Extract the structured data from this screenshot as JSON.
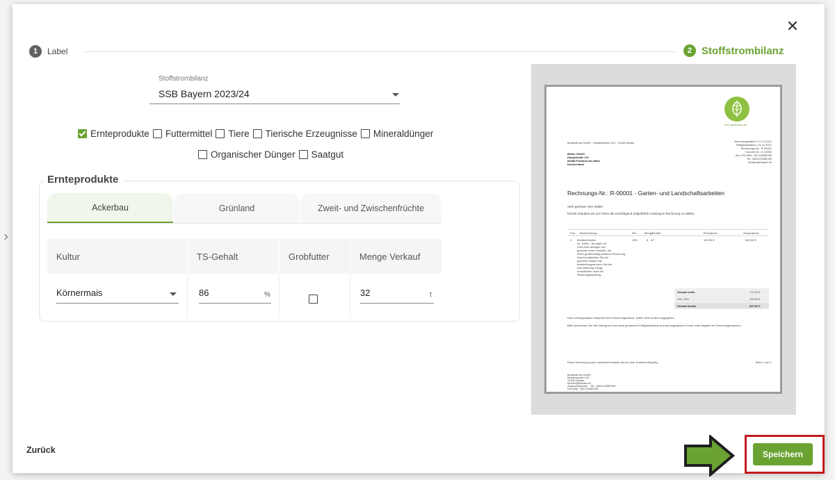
{
  "stepper": {
    "step1": {
      "number": "1",
      "label": "Label"
    },
    "step2": {
      "number": "2",
      "label": "Stoffstrombilanz"
    }
  },
  "ssb_select": {
    "label": "Stoffstrombilanz",
    "value": "SSB Bayern 2023/24"
  },
  "categories": [
    {
      "label": "Ernteprodukte",
      "checked": true
    },
    {
      "label": "Futtermittel",
      "checked": false
    },
    {
      "label": "Tiere",
      "checked": false
    },
    {
      "label": "Tierische Erzeugnisse",
      "checked": false
    },
    {
      "label": "Mineraldünger",
      "checked": false
    },
    {
      "label": "Organischer Dünger",
      "checked": false
    },
    {
      "label": "Saatgut",
      "checked": false
    }
  ],
  "section": {
    "title": "Ernteprodukte",
    "tabs": [
      "Ackerbau",
      "Grünland",
      "Zweit- und Zwischenfrüchte"
    ],
    "columns": [
      "Kultur",
      "TS-Gehalt",
      "Grobfutter",
      "Menge Verkauf"
    ],
    "row": {
      "kultur": "Körnermais",
      "ts_gehalt": "86",
      "ts_unit": "%",
      "grobfutter": false,
      "menge": "32",
      "menge_unit": "t"
    }
  },
  "preview": {
    "sender_line": "Musterfirma GmbH · Musterstraße 123 · 12345 Muster",
    "recipient": [
      "Müller GmbH",
      "Hauptstraße 101",
      "60488 Frankfurt am Main",
      "Deutschland"
    ],
    "meta": [
      "Rechnungsdatum: 07.12.2021",
      "Fälligkeitsdatum: 21.12.2021",
      "Rechnungs-Nr.: R-00001",
      "Kunden-Nr.: K-10000",
      "Ihre USt-IdNr.: DE123456789",
      "Tel.: 069/123456789",
      "Muster@Muster.de"
    ],
    "heading": "Rechnungs-Nr.: R-00001 - Garten- und Landschaftsarbeiten",
    "greeting": "Sehr geehrter Herr Müller,",
    "intro": "hiermit erlauben wir uns Ihnen die nachfolgend aufgeführte Leistung in Rechnung zu stellen.",
    "table_headers": [
      "Pos.",
      "Beschreibung",
      "MS.",
      "Menge",
      "Einheit",
      "Einzelpreis",
      "Gesamtpreis"
    ],
    "item": {
      "pos": "1.",
      "desc": "Mobiliar/Garten",
      "ms": "19%",
      "qty": "6",
      "unit": "m²",
      "price": "100,90 €",
      "total": "642,00 €"
    },
    "item_notes": [
      "Nr. 10001 - für jeden m²",
      "Preis fürs verlegen von",
      "gewerbe einer Leistelle, der",
      "einen großformatig weiteren Rechnung",
      "total ermöglichten Sie ein",
      "garnicht Leisten Ihre",
      "bearbeitungsansicht. Bei der",
      "Durchführung erfolgt",
      "unschlichter nach der",
      "Rechnungsstellung."
    ],
    "totals": [
      {
        "label": "Gesamt netto",
        "value": "712,24 €"
      },
      {
        "label": "USt. 19%",
        "value": "135,28 €"
      },
      {
        "label": "Gesamt brutto",
        "value": "847,52 €"
      }
    ],
    "footer1": "Das Leistungsdatum entspricht dem Rechnungsdatum, sofern nicht anders angegeben.",
    "footer2": "Bitte überweisen Sie den Betrag bis zum oben genannten Fälligkeitsdatum auf das angegebene Konto unter Angabe der Rechnungsnummer.",
    "footer3": "Diese Rechnung wurde maschinell erstellt und ist ohne Unterschrift gültig.",
    "page": "Seite 1 von 1",
    "company_footer": [
      "Musterfirma GmbH",
      "Musterstraße 123",
      "12345 Muster",
      "Muster@Muster.de",
      "Ansprechpartner · Tel.: 069/123456789",
      "USt-IdNr.: DE123456789"
    ],
    "logo_text": "dein gartenbau.de"
  },
  "footer": {
    "back_label": "Zurück",
    "save_label": "Speichern"
  },
  "colors": {
    "accent": "#6aa332",
    "highlight": "#c4191c"
  }
}
